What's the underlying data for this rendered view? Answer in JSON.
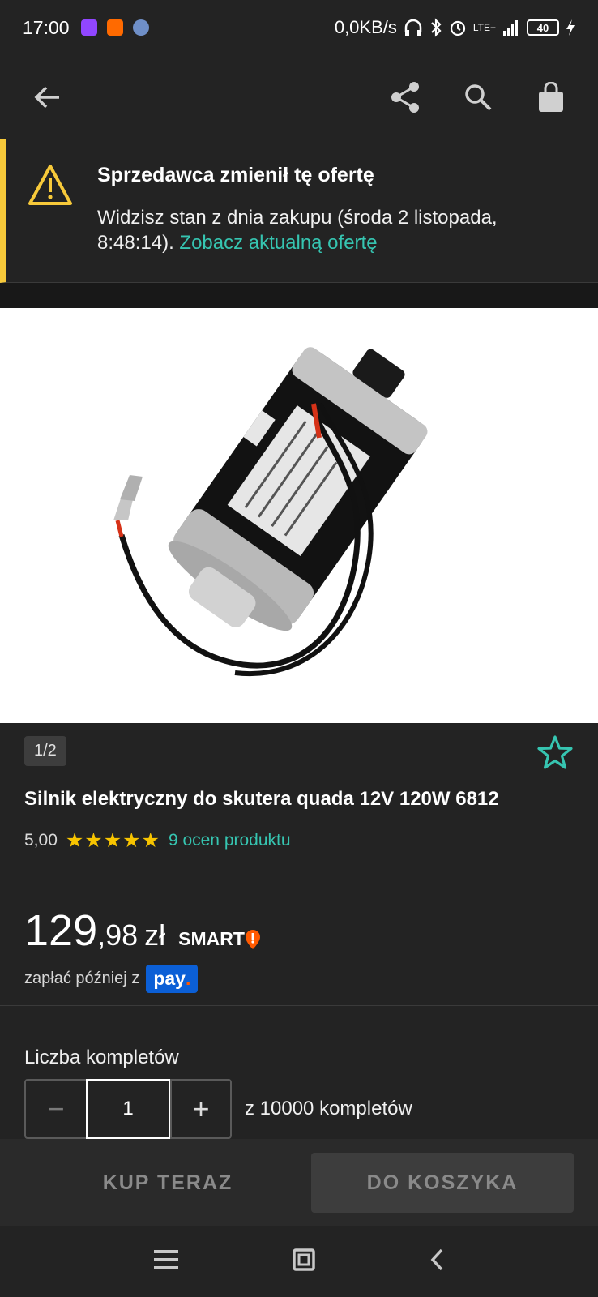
{
  "status_bar": {
    "time": "17:00",
    "network_speed": "0,0KB/s",
    "network_type": "LTE+",
    "battery": "40"
  },
  "toolbar": {
    "back_icon": "arrow-left-icon",
    "share_icon": "share-icon",
    "search_icon": "search-icon",
    "bag_icon": "shopping-bag-icon"
  },
  "notice": {
    "title": "Sprzedawca zmienił tę ofertę",
    "text": "Widzisz stan z dnia zakupu (środa 2 listopada, 8:48:14).",
    "link": "Zobacz aktualną ofertę",
    "accent_color": "#f7c93a"
  },
  "gallery": {
    "counter": "1/2"
  },
  "product": {
    "title": "Silnik elektryczny do skutera quada 12V 120W 6812",
    "rating_value": "5,00",
    "stars": "★★★★★",
    "rating_link": "9 ocen produktu"
  },
  "price": {
    "integer": "129",
    "decimal": ",98",
    "currency": "zł",
    "smart_label": "SMART",
    "pay_later_label": "zapłać później z",
    "pay_brand": "pay",
    "pay_dot": "."
  },
  "quantity": {
    "label": "Liczba kompletów",
    "minus": "−",
    "value": "1",
    "plus": "+",
    "available": "z 10000 kompletów"
  },
  "actions": {
    "buy_now": "KUP TERAZ",
    "add_to_cart": "DO KOSZYKA"
  },
  "colors": {
    "accent_teal": "#36c5b1",
    "star": "#f7c400",
    "background": "#232323"
  }
}
